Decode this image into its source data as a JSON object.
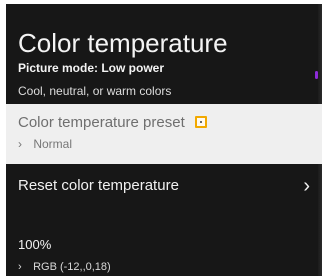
{
  "title": "Color temperature",
  "subtitle": "Picture mode: Low power",
  "description": "Cool, neutral, or warm colors",
  "menu": [
    {
      "label": "Color temperature preset",
      "value": "Normal"
    },
    {
      "label": "Reset color temperature"
    }
  ],
  "footer": {
    "percent": "100%",
    "rgb": "RGB (-12,,0,18)"
  },
  "icons": {
    "options": "options-icon",
    "chevron_small": "chevron-right-small-icon",
    "chevron_large": "chevron-right-icon"
  },
  "colors": {
    "background": "#171717",
    "selected_background": "#efefef",
    "accent": "#f2a900",
    "purple_edge": "#8d2bd8"
  }
}
